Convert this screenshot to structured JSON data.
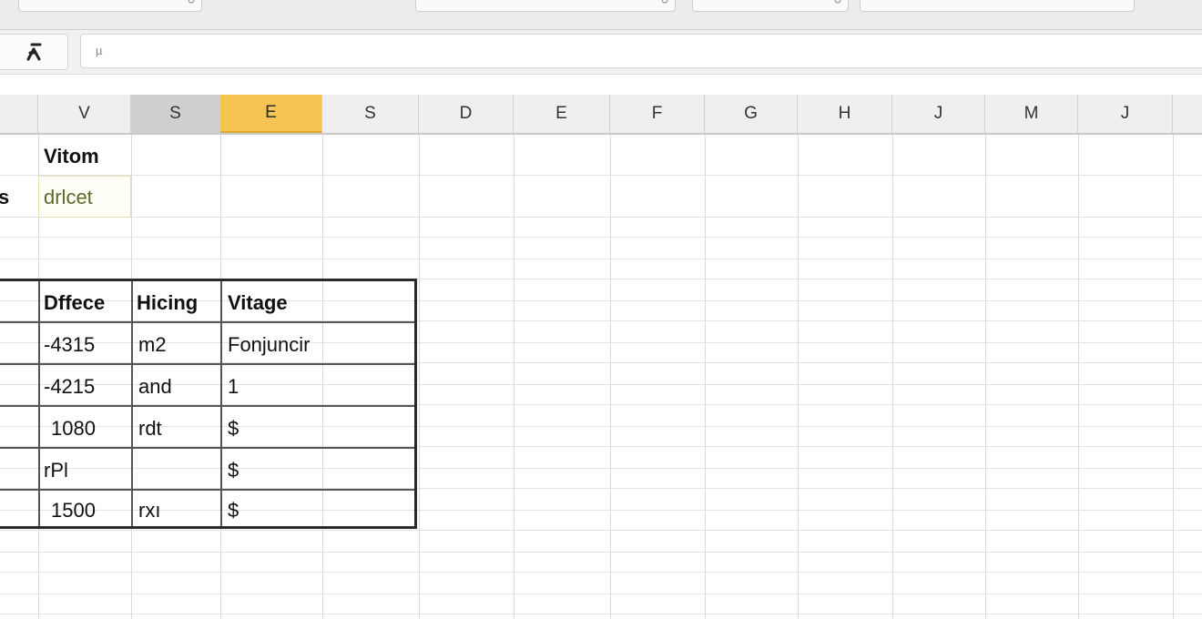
{
  "toolbar": {
    "selects": [
      "",
      "",
      "",
      ""
    ]
  },
  "formula_bar": {
    "fx_icon": "function-icon",
    "content": "µ"
  },
  "columns": [
    "V",
    "S",
    "E",
    "S",
    "D",
    "E",
    "F",
    "G",
    "H",
    "J",
    "M",
    "J"
  ],
  "cells": {
    "r1_colV": "Vitom",
    "r2_colA": "s",
    "r2_colV": "drlcet"
  },
  "table": {
    "headers": [
      "Dffece",
      "Hicing",
      "Vitage"
    ],
    "rows": [
      [
        "-4315",
        "m2",
        "Fonjuncir"
      ],
      [
        "-4215",
        "and",
        "1"
      ],
      [
        "1080",
        "rdt",
        "$"
      ],
      [
        "rPl",
        "",
        "$"
      ],
      [
        "1500",
        "rxı",
        "$"
      ]
    ]
  }
}
